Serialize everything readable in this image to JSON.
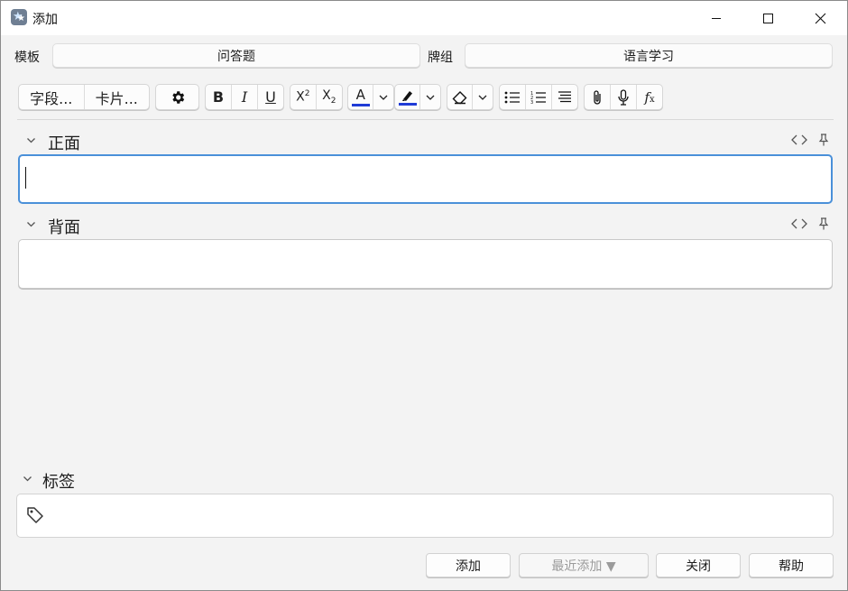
{
  "window": {
    "title": "添加"
  },
  "notetype": {
    "label": "模板",
    "value": "问答题"
  },
  "deck": {
    "label": "牌组",
    "value": "语言学习"
  },
  "toolbar": {
    "fields_label": "字段...",
    "cards_label": "卡片..."
  },
  "fields": [
    {
      "name": "正面",
      "value": ""
    },
    {
      "name": "背面",
      "value": ""
    }
  ],
  "tags": {
    "label": "标签",
    "value": ""
  },
  "buttons": {
    "add": "添加",
    "history": "最近添加 ▼",
    "close": "关闭",
    "help": "帮助"
  },
  "colors": {
    "text_color_bar": "#1f3bd6",
    "highlight_color_bar": "#1f3bd6",
    "focus_border": "#4a90d9"
  }
}
